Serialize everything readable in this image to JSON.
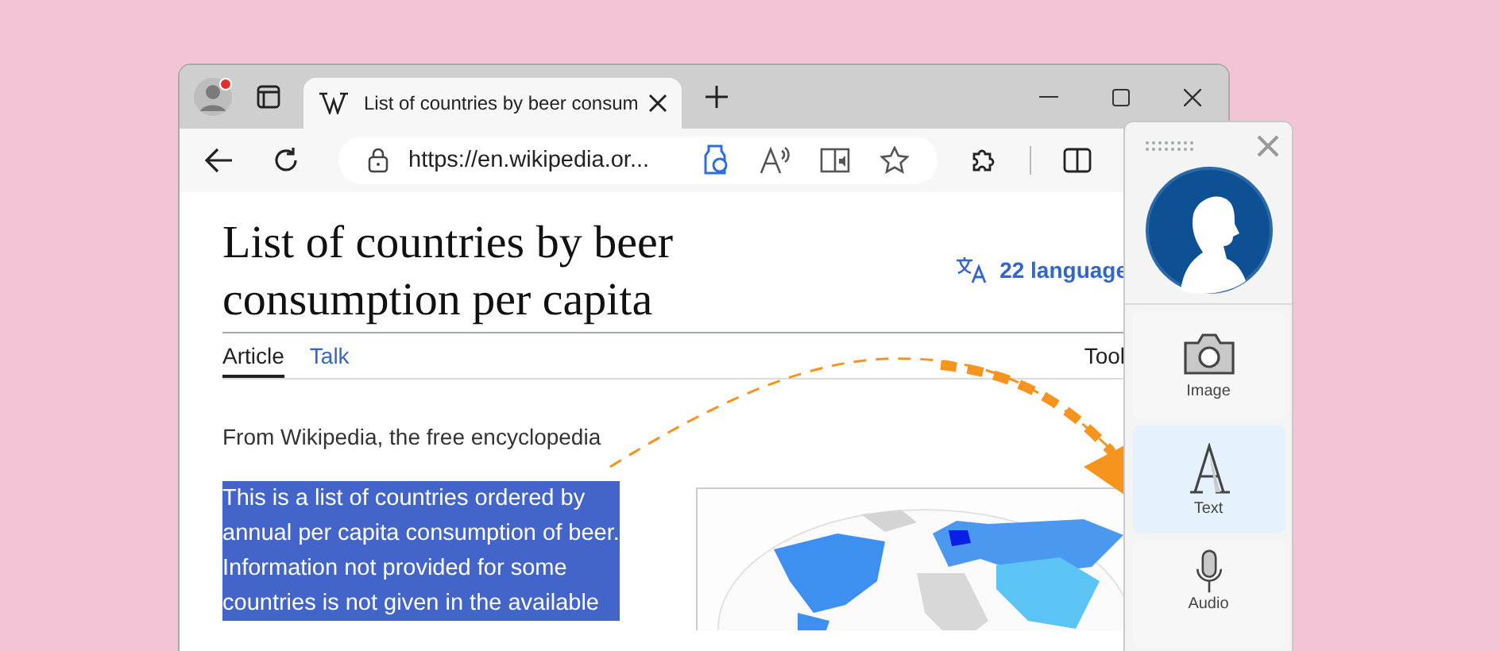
{
  "browser": {
    "tab": {
      "title": "List of countries by beer consum",
      "selected": true
    },
    "address": "https://en.wikipedia.or..."
  },
  "article": {
    "title": "List of countries by beer consumption per capita",
    "languages": "22 language",
    "tabs": [
      {
        "label": "Article",
        "selected": true
      },
      {
        "label": "Talk",
        "selected": false
      }
    ],
    "tools": "Tool",
    "tagline": "From Wikipedia, the free encyclopedia",
    "intro": {
      "highlighted": true,
      "lines": [
        "This is a list of countries ordered by",
        "annual per capita consumption of beer.",
        "Information not provided for some",
        "countries is not given in the available"
      ]
    }
  },
  "panel": {
    "buttons": [
      {
        "kind": "image",
        "label": "Image",
        "selected": false
      },
      {
        "kind": "text",
        "label": "Text",
        "selected": true
      },
      {
        "kind": "audio",
        "label": "Audio",
        "selected": false
      }
    ]
  }
}
